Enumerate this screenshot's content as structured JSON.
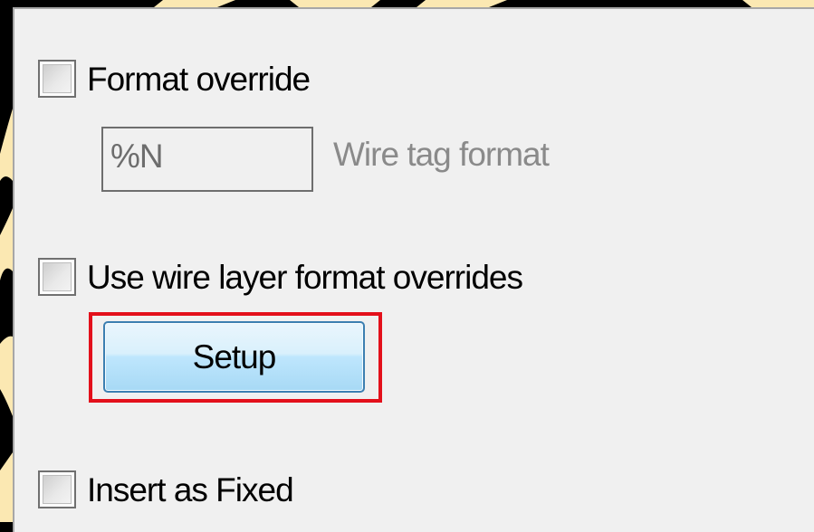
{
  "options": {
    "format_override_label": "Format override",
    "format_override_checked": false,
    "wire_tag_value": "%N",
    "wire_tag_hint": "Wire tag format",
    "use_layer_overrides_label": "Use wire layer format overrides",
    "use_layer_overrides_checked": false,
    "setup_label": "Setup",
    "insert_fixed_label": "Insert as Fixed",
    "insert_fixed_checked": false
  },
  "colors": {
    "highlight": "#e3101b",
    "button_border": "#3c7fb1",
    "background_accent": "#fbe8b2"
  }
}
